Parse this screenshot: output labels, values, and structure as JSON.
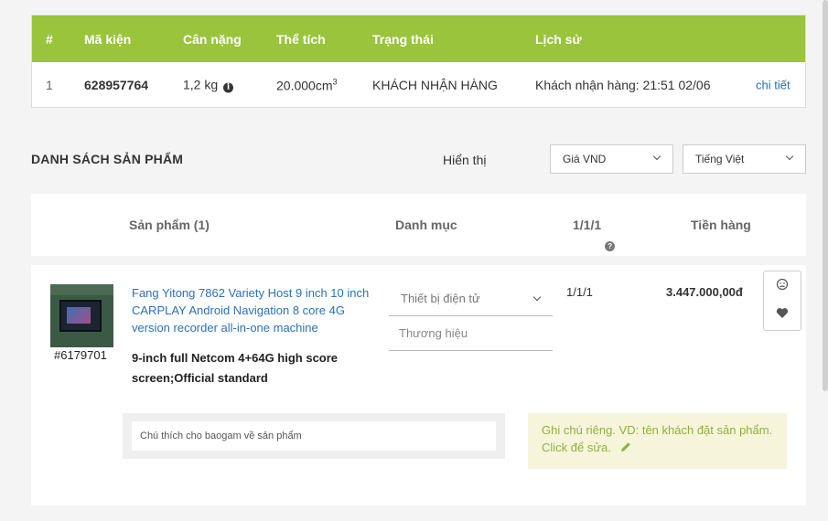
{
  "package_table": {
    "headers": [
      "#",
      "Mã kiện",
      "Cân nặng",
      "Thể tích",
      "Trạng thái",
      "Lịch sử"
    ],
    "row": {
      "index": "1",
      "package_code": "628957764",
      "weight": "1,2 kg",
      "volume": "20.000cm",
      "volume_sup": "3",
      "status": "KHÁCH NHẬN HÀNG",
      "history": "Khách nhận hàng: 21:51 02/06",
      "detail_link": "chi tiết"
    },
    "header_color": "#99c43c"
  },
  "product_list": {
    "title": "DANH SÁCH SẢN PHẨM",
    "show_label": "Hiển thị",
    "currency_select": "Giá VND",
    "language_select": "Tiếng Việt"
  },
  "product_table": {
    "headers": {
      "product": "Sản phẩm (1)",
      "category": "Danh mục",
      "quantity": "1/1/1",
      "amount": "Tiền hàng"
    }
  },
  "product": {
    "sku": "#6179701",
    "name": "Fang Yitong 7862 Variety Host 9 inch 10 inch CARPLAY Android Navigation 8 core 4G version recorder all-in-one machine",
    "variant": "9-inch full Netcom 4+64G high score screen;Official standard",
    "category_value": "Thiết bị điện tử",
    "brand_placeholder": "Thương hiệu",
    "quantity": "1/1/1",
    "price": "3.447.000,00đ",
    "note_placeholder": "Chú thích cho baogam về sản phẩm",
    "private_note": "Ghi chú riêng. VD: tên khách đặt sản phẩm. Click để sửa."
  },
  "icons": [
    "info-icon",
    "question-icon",
    "chevron-down-icon",
    "frown-icon",
    "heart-icon",
    "pencil-icon"
  ]
}
